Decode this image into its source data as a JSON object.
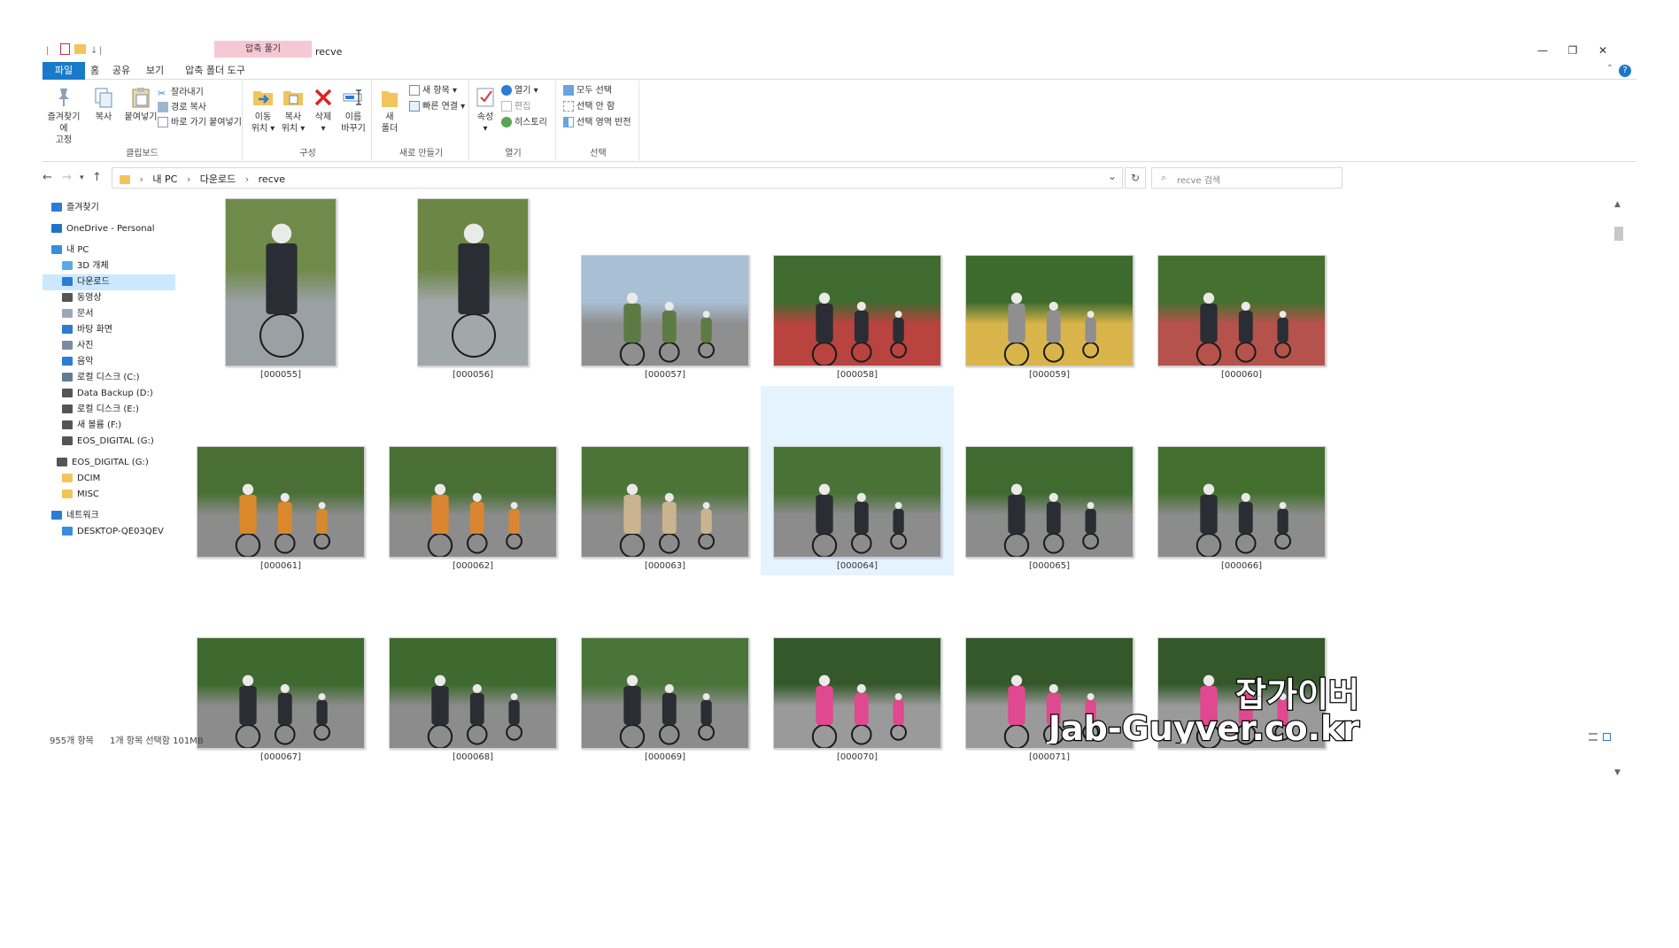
{
  "window": {
    "title": "recve",
    "context_tab": "압축 풀기",
    "quick_access": [
      "↓",
      "|"
    ],
    "controls": {
      "minimize": "—",
      "restore": "❐",
      "close": "✕"
    }
  },
  "tabs": [
    {
      "label": "파일"
    },
    {
      "label": "홈"
    },
    {
      "label": "공유"
    },
    {
      "label": "보기"
    },
    {
      "label": "압축 폴더 도구"
    }
  ],
  "help_label": "?",
  "ribbon": {
    "clipboard": {
      "label": "클립보드",
      "pin": "즐겨찾기에\n고정",
      "copy": "복사",
      "paste": "붙여넣기",
      "cut": "잘라내기",
      "copy_path": "경로 복사",
      "paste_shortcut": "바로 가기 붙여넣기"
    },
    "organize": {
      "label": "구성",
      "move_to": "이동\n위치 ▾",
      "copy_to": "복사\n위치 ▾",
      "delete": "삭제\n▾",
      "rename": "이름\n바꾸기"
    },
    "new": {
      "label": "새로 만들기",
      "new_folder": "새\n폴더",
      "new_item": "새 항목 ▾",
      "easy_access": "빠른 연결 ▾"
    },
    "open": {
      "label": "열기",
      "properties": "속성\n▾",
      "open": "열기 ▾",
      "edit": "편집",
      "history": "히스토리"
    },
    "select": {
      "label": "선택",
      "select_all": "모두 선택",
      "select_none": "선택 안 함",
      "invert": "선택 영역 반전"
    }
  },
  "address": {
    "back": "←",
    "forward": "→",
    "recent": "▾",
    "up": "↑",
    "crumbs": [
      "내 PC",
      "다운로드",
      "recve"
    ],
    "dropdown": "⌄",
    "refresh": "↻",
    "search_placeholder": "recve 검색"
  },
  "nav": [
    {
      "label": "즐겨찾기",
      "icon": "star-icon",
      "color": "#2b7cd3"
    },
    {
      "label": "OneDrive - Personal",
      "icon": "cloud-icon",
      "color": "#1e73c9"
    },
    {
      "label": "내 PC",
      "icon": "pc-icon",
      "color": "#3a8dde"
    },
    {
      "label": "3D 개체",
      "icon": "cube-icon",
      "color": "#5aa9e6"
    },
    {
      "label": "다운로드",
      "icon": "download-icon",
      "color": "#2b7cd3",
      "selected": true
    },
    {
      "label": "동영상",
      "icon": "video-icon",
      "color": "#555555"
    },
    {
      "label": "문서",
      "icon": "document-icon",
      "color": "#9aa7b8"
    },
    {
      "label": "바탕 화면",
      "icon": "desktop-icon",
      "color": "#2b7cd3"
    },
    {
      "label": "사진",
      "icon": "picture-icon",
      "color": "#7a8aa0"
    },
    {
      "label": "음악",
      "icon": "music-icon",
      "color": "#2b7cd3"
    },
    {
      "label": "로컬 디스크 (C:)",
      "icon": "drive-c-icon",
      "color": "#5f7d95"
    },
    {
      "label": "Data Backup (D:)",
      "icon": "drive-d-icon",
      "color": "#555555"
    },
    {
      "label": "로컬 디스크 (E:)",
      "icon": "drive-e-icon",
      "color": "#555555"
    },
    {
      "label": "새 볼륨 (F:)",
      "icon": "drive-f-icon",
      "color": "#555555"
    },
    {
      "label": "EOS_DIGITAL (G:)",
      "icon": "drive-g-icon",
      "color": "#555555"
    },
    {
      "label": "EOS_DIGITAL (G:)",
      "icon": "drive-g2-icon",
      "color": "#555555"
    },
    {
      "label": "DCIM",
      "icon": "folder-icon",
      "color": "#f2c55c"
    },
    {
      "label": "MISC",
      "icon": "folder-icon",
      "color": "#f2c55c"
    },
    {
      "label": "네트워크",
      "icon": "network-icon",
      "color": "#2b7cd3"
    },
    {
      "label": "DESKTOP-QE03QEV",
      "icon": "computer-icon",
      "color": "#3a8dde"
    }
  ],
  "files": [
    {
      "name": "[000055]",
      "kind": "portrait",
      "palette": [
        "#6f8a4a",
        "#2a2d33",
        "#9aa0a4"
      ]
    },
    {
      "name": "[000056]",
      "kind": "portrait",
      "palette": [
        "#6b8645",
        "#2a2d33",
        "#a2a7aa"
      ]
    },
    {
      "name": "[000057]",
      "kind": "landscape",
      "palette": [
        "#a9bfd3",
        "#5d7a45",
        "#8f8f8f"
      ]
    },
    {
      "name": "[000058]",
      "kind": "landscape",
      "palette": [
        "#3f6a30",
        "#2a2d33",
        "#b8433f"
      ]
    },
    {
      "name": "[000059]",
      "kind": "landscape",
      "palette": [
        "#3d6b2e",
        "#8f8f8f",
        "#d9b44a"
      ]
    },
    {
      "name": "[000060]",
      "kind": "landscape",
      "palette": [
        "#45702f",
        "#2a2d33",
        "#b6524c"
      ]
    },
    {
      "name": "[000061]",
      "kind": "landscape",
      "palette": [
        "#4a6f34",
        "#d9882a",
        "#8c8c8c"
      ]
    },
    {
      "name": "[000062]",
      "kind": "landscape",
      "palette": [
        "#4a6f34",
        "#d98532",
        "#8c8c8c"
      ]
    },
    {
      "name": "[000063]",
      "kind": "landscape",
      "palette": [
        "#4d7437",
        "#c9b48f",
        "#8c8c8c"
      ]
    },
    {
      "name": "[000064]",
      "kind": "landscape",
      "palette": [
        "#4a7236",
        "#2a2d33",
        "#8c8c8c"
      ],
      "selected": true
    },
    {
      "name": "[000065]",
      "kind": "landscape",
      "palette": [
        "#3f6a30",
        "#2a2d33",
        "#8c8c8c"
      ]
    },
    {
      "name": "[000066]",
      "kind": "landscape",
      "palette": [
        "#44702f",
        "#2a2d33",
        "#8c8c8c"
      ]
    },
    {
      "name": "[000067]",
      "kind": "landscape",
      "palette": [
        "#3e6a2f",
        "#2a2d33",
        "#8c8c8c"
      ]
    },
    {
      "name": "[000068]",
      "kind": "landscape",
      "palette": [
        "#3e6a2f",
        "#2a2d33",
        "#8c8c8c"
      ]
    },
    {
      "name": "[000069]",
      "kind": "landscape",
      "palette": [
        "#4a7438",
        "#2a2d33",
        "#8c8c8c"
      ]
    },
    {
      "name": "[000070]",
      "kind": "landscape",
      "palette": [
        "#34582a",
        "#e0488f",
        "#9a9a9a"
      ]
    },
    {
      "name": "[000071]",
      "kind": "landscape",
      "palette": [
        "#34582a",
        "#e0488f",
        "#9a9a9a"
      ]
    },
    {
      "name": "",
      "kind": "landscape",
      "palette": [
        "#34582a",
        "#e0488f",
        "#9a9a9a"
      ]
    }
  ],
  "status": {
    "item_count": "955개 항목",
    "selection": "1개 항목 선택함 101MB"
  },
  "watermark": {
    "line1": "잡가이버",
    "line2": "Jab-Guyver.co.kr"
  },
  "colors": {
    "accent": "#1979ca",
    "selection": "#cce8ff",
    "tile_selected": "#e5f3ff"
  }
}
